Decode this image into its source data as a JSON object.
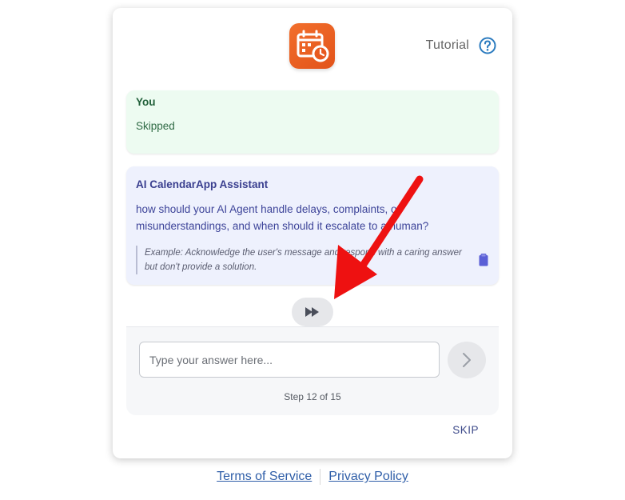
{
  "header": {
    "logo_icon": "calendar-clock-icon",
    "tutorial_label": "Tutorial",
    "help_icon": "help-circle-icon"
  },
  "messages": {
    "user": {
      "sender": "You",
      "text": "Skipped"
    },
    "assistant": {
      "sender": "AI CalendarApp Assistant",
      "text": "how should your AI Agent handle delays, complaints, or misunderstandings, and when should it escalate to a human?",
      "example": "Example: Acknowledge the user's message and respond with a caring answer but don't provide a solution.",
      "copy_icon": "clipboard-icon"
    }
  },
  "controls": {
    "fast_forward_icon": "fast-forward-icon",
    "answer_placeholder": "Type your answer here...",
    "send_icon": "chevron-right-icon",
    "step_text": "Step 12 of 15",
    "skip_label": "SKIP"
  },
  "footer": {
    "terms_label": "Terms of Service",
    "privacy_label": "Privacy Policy"
  },
  "colors": {
    "brand_orange": "#e8591f",
    "user_bubble": "#edfbf1",
    "assistant_bubble": "#eef1fd",
    "annotation_arrow": "#ee1111",
    "link": "#2f5ea8"
  }
}
